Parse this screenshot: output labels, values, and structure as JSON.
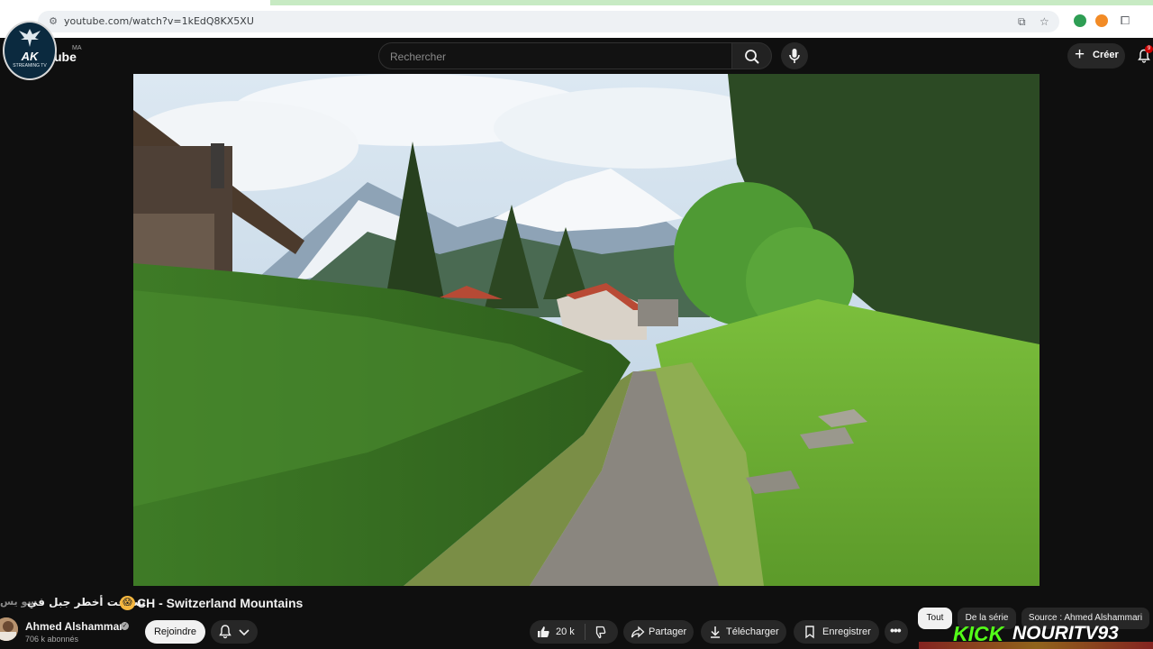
{
  "browser": {
    "url": "youtube.com/watch?v=1kEdQ8KX5XU"
  },
  "header": {
    "logo_text": "ube",
    "country_code": "MA",
    "search_placeholder": "Rechercher",
    "create_label": "Créer",
    "notifications_count": "9"
  },
  "watermark": {
    "text": "AK",
    "subtext": "STREAMING TV"
  },
  "video": {
    "title_clipped": "سو يس",
    "title_arabic": "تسلقت أخطر جبل في",
    "title_english": "CH - Switzerland Mountains"
  },
  "channel": {
    "name": "Ahmed Alshammari",
    "subscribers": "706 k abonnés",
    "join_label": "Rejoindre"
  },
  "actions": {
    "likes": "20 k",
    "share_label": "Partager",
    "download_label": "Télécharger",
    "save_label": "Enregistrer"
  },
  "chips": [
    "Tout",
    "De la série",
    "Source : Ahmed Alshammari"
  ],
  "overlay": {
    "kick": "KICK",
    "name": "NOURITV93"
  },
  "colors": {
    "background": "#0f0f0f",
    "button": "#272727",
    "kick_green": "#53fc18"
  }
}
